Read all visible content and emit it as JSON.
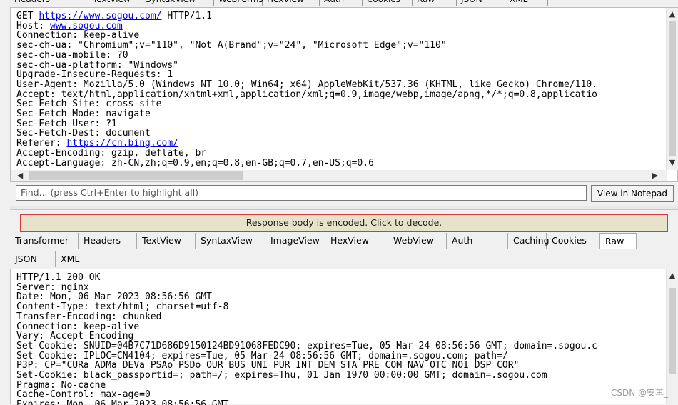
{
  "top_tabs": [
    "Headers",
    "TextView",
    "SyntaxView",
    "WebForms",
    "HexView",
    "Auth",
    "Cookies",
    "Raw",
    "JSON",
    "XML"
  ],
  "request": {
    "lines": [
      {
        "parts": [
          {
            "t": "GET "
          },
          {
            "t": "https://www.sogou.com/",
            "link": true
          },
          {
            "t": " HTTP/1.1"
          }
        ]
      },
      {
        "parts": [
          {
            "t": "Host: "
          },
          {
            "t": "www.sogou.com",
            "link": true
          }
        ]
      },
      {
        "parts": [
          {
            "t": "Connection: keep-alive"
          }
        ]
      },
      {
        "parts": [
          {
            "t": "sec-ch-ua: \"Chromium\";v=\"110\", \"Not A(Brand\";v=\"24\", \"Microsoft Edge\";v=\"110\""
          }
        ]
      },
      {
        "parts": [
          {
            "t": "sec-ch-ua-mobile: ?0"
          }
        ]
      },
      {
        "parts": [
          {
            "t": "sec-ch-ua-platform: \"Windows\""
          }
        ]
      },
      {
        "parts": [
          {
            "t": "Upgrade-Insecure-Requests: 1"
          }
        ]
      },
      {
        "parts": [
          {
            "t": "User-Agent: Mozilla/5.0 (Windows NT 10.0; Win64; x64) AppleWebKit/537.36 (KHTML, like Gecko) Chrome/110."
          }
        ]
      },
      {
        "parts": [
          {
            "t": "Accept: text/html,application/xhtml+xml,application/xml;q=0.9,image/webp,image/apng,*/*;q=0.8,applicatio"
          }
        ]
      },
      {
        "parts": [
          {
            "t": "Sec-Fetch-Site: cross-site"
          }
        ]
      },
      {
        "parts": [
          {
            "t": "Sec-Fetch-Mode: navigate"
          }
        ]
      },
      {
        "parts": [
          {
            "t": "Sec-Fetch-User: ?1"
          }
        ]
      },
      {
        "parts": [
          {
            "t": "Sec-Fetch-Dest: document"
          }
        ]
      },
      {
        "parts": [
          {
            "t": "Referer: "
          },
          {
            "t": "https://cn.bing.com/",
            "link": true
          }
        ]
      },
      {
        "parts": [
          {
            "t": "Accept-Encoding: gzip, deflate, br"
          }
        ]
      },
      {
        "parts": [
          {
            "t": "Accept-Language: zh-CN,zh;q=0.9,en;q=0.8,en-GB;q=0.7,en-US;q=0.6"
          }
        ]
      }
    ]
  },
  "find": {
    "placeholder": "Find... (press Ctrl+Enter to highlight all)",
    "notepad_label": "View in Notepad"
  },
  "decode_bar": "Response body is encoded. Click to decode.",
  "response_tabs_row1": [
    "Transformer",
    "Headers",
    "TextView",
    "SyntaxView",
    "ImageView",
    "HexView",
    "WebView",
    "Auth",
    "Caching",
    "Cookies",
    "Raw"
  ],
  "response_tabs_row2": [
    "JSON",
    "XML"
  ],
  "response_active_tab": "Raw",
  "response": {
    "lines": [
      "HTTP/1.1 200 OK",
      "Server: nginx",
      "Date: Mon, 06 Mar 2023 08:56:56 GMT",
      "Content-Type: text/html; charset=utf-8",
      "Transfer-Encoding: chunked",
      "Connection: keep-alive",
      "Vary: Accept-Encoding",
      "Set-Cookie: SNUID=04B7C71D686D9150124BD91068FEDC90; expires=Tue, 05-Mar-24 08:56:56 GMT; domain=.sogou.c",
      "Set-Cookie: IPLOC=CN4104; expires=Tue, 05-Mar-24 08:56:56 GMT; domain=.sogou.com; path=/",
      "P3P: CP=\"CURa ADMa DEVa PSAo PSDo OUR BUS UNI PUR INT DEM STA PRE COM NAV OTC NOI DSP COR\"",
      "Set-Cookie: black_passportid=; path=/; expires=Thu, 01 Jan 1970 00:00:00 GMT; domain=.sogou.com",
      "Pragma: No-cache",
      "Cache-Control: max-age=0",
      "Expires: Mon, 06 Mar 2023 08:56:56 GMT"
    ]
  },
  "watermark": "CSDN @安苒_",
  "colors": {
    "link": "#0000ee",
    "decode_bg": "#e6e3ca",
    "decode_border": "#d83a3a"
  }
}
